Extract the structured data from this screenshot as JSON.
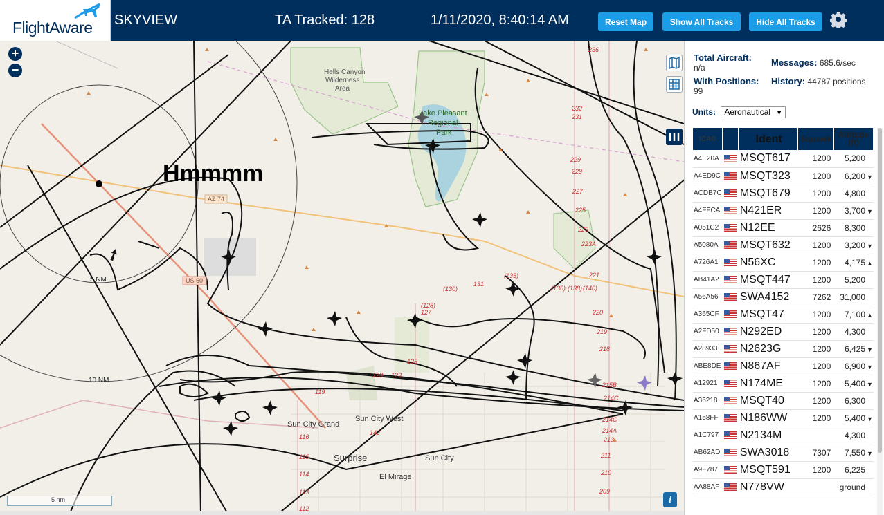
{
  "header": {
    "logo_text": "FlightAware",
    "site_name": "SKYVIEW",
    "tracked": "TA Tracked: 128",
    "clock": "1/11/2020, 8:40:14 AM",
    "buttons": {
      "reset": "Reset Map",
      "show": "Show All Tracks",
      "hide": "Hide All Tracks"
    }
  },
  "map": {
    "note": "Hmmmm",
    "range_rings": [
      "5 NM",
      "10 NM"
    ],
    "scale_label": "5 nm",
    "places": [
      "Hells Canyon Wilderness Area",
      "Lake Pleasant Regional Park",
      "Sun City Grand",
      "Sun City West",
      "Surprise",
      "Sun City",
      "El Mirage"
    ],
    "roads": [
      "AZ 74",
      "US 60"
    ],
    "route_numbers": [
      "236",
      "232",
      "231",
      "229",
      "229",
      "227",
      "225",
      "223",
      "223A",
      "221",
      "220",
      "219",
      "218",
      "215B",
      "214C",
      "214C",
      "214A",
      "213",
      "211",
      "210",
      "209",
      "131",
      "130",
      "128",
      "127",
      "125",
      "123",
      "123",
      "119",
      "116",
      "115",
      "114",
      "113",
      "112",
      "142",
      "(135)",
      "(136)",
      "(138)",
      "(140)"
    ],
    "info": "i"
  },
  "stats": {
    "total_label": "Total Aircraft:",
    "total_value": "n/a",
    "positions_label": "With Positions:",
    "positions_value": "99",
    "messages_label": "Messages:",
    "messages_value": "685.6/sec",
    "history_label": "History:",
    "history_value": "44787 positions",
    "units_label": "Units:",
    "units_value": "Aeronautical"
  },
  "table": {
    "columns": [
      "ICAO",
      "Ident",
      "Squawk",
      "Altitude (ft)"
    ],
    "rows": [
      {
        "icao": "A4E20A",
        "ident": "MSQT617",
        "squawk": "1200",
        "alt": "5,200",
        "trend": ""
      },
      {
        "icao": "A4ED9C",
        "ident": "MSQT323",
        "squawk": "1200",
        "alt": "6,200",
        "trend": "▼"
      },
      {
        "icao": "ACDB7C",
        "ident": "MSQT679",
        "squawk": "1200",
        "alt": "4,800",
        "trend": ""
      },
      {
        "icao": "A4FFCA",
        "ident": "N421ER",
        "squawk": "1200",
        "alt": "3,700",
        "trend": "▼"
      },
      {
        "icao": "A051C2",
        "ident": "N12EE",
        "squawk": "2626",
        "alt": "8,300",
        "trend": ""
      },
      {
        "icao": "A5080A",
        "ident": "MSQT632",
        "squawk": "1200",
        "alt": "3,200",
        "trend": "▼"
      },
      {
        "icao": "A726A1",
        "ident": "N56XC",
        "squawk": "1200",
        "alt": "4,175",
        "trend": "▲"
      },
      {
        "icao": "AB41A2",
        "ident": "MSQT447",
        "squawk": "1200",
        "alt": "5,200",
        "trend": ""
      },
      {
        "icao": "A56A56",
        "ident": "SWA4152",
        "squawk": "7262",
        "alt": "31,000",
        "trend": ""
      },
      {
        "icao": "A365CF",
        "ident": "MSQT47",
        "squawk": "1200",
        "alt": "7,100",
        "trend": "▲"
      },
      {
        "icao": "A2FD50",
        "ident": "N292ED",
        "squawk": "1200",
        "alt": "4,300",
        "trend": ""
      },
      {
        "icao": "A28933",
        "ident": "N2623G",
        "squawk": "1200",
        "alt": "6,425",
        "trend": "▼"
      },
      {
        "icao": "ABE8DE",
        "ident": "N867AF",
        "squawk": "1200",
        "alt": "6,900",
        "trend": "▼"
      },
      {
        "icao": "A12921",
        "ident": "N174ME",
        "squawk": "1200",
        "alt": "5,400",
        "trend": "▼"
      },
      {
        "icao": "A36218",
        "ident": "MSQT40",
        "squawk": "1200",
        "alt": "6,300",
        "trend": ""
      },
      {
        "icao": "A158FF",
        "ident": "N186WW",
        "squawk": "1200",
        "alt": "5,400",
        "trend": "▼"
      },
      {
        "icao": "A1C797",
        "ident": "N2134M",
        "squawk": "",
        "alt": "4,300",
        "trend": ""
      },
      {
        "icao": "AB62AD",
        "ident": "SWA3018",
        "squawk": "7307",
        "alt": "7,550",
        "trend": "▼"
      },
      {
        "icao": "A9F787",
        "ident": "MSQT591",
        "squawk": "1200",
        "alt": "6,225",
        "trend": ""
      },
      {
        "icao": "AA88AF",
        "ident": "N778VW",
        "squawk": "",
        "alt": "ground",
        "trend": ""
      }
    ]
  },
  "colors": {
    "header_bg": "#002f5d",
    "button_bg": "#1b9de8",
    "map_bg": "#f2efe9"
  }
}
